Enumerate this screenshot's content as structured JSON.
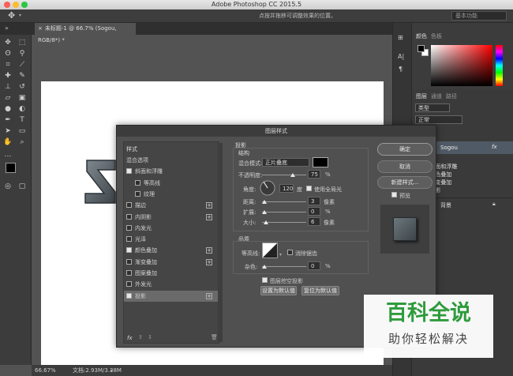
{
  "app": {
    "title": "Adobe Photoshop CC 2015.5"
  },
  "options_bar": {
    "hint": "点按并拖移可调整效果的位置。",
    "workspace": "基本功能"
  },
  "document": {
    "tab_label": "未标题-1 @ 66.7% (Sogou, RGB/8*) *",
    "close_glyph": "×"
  },
  "status": {
    "zoom": "66.67%",
    "doc_size": "文档:2.93M/3.38M"
  },
  "panels": {
    "color_tabs": [
      "颜色",
      "色板"
    ],
    "layer_tabs": [
      "图层",
      "通道",
      "路径"
    ],
    "filter_kind": "类型",
    "blend_mode": "正常",
    "layer_name": "Sogou",
    "fx_glyph": "fx",
    "effects_label": "效果",
    "effects": [
      "斜面和浮雕",
      "颜色叠加",
      "渐变叠加",
      "投影"
    ],
    "background_layer": "背景"
  },
  "dialog": {
    "title": "图层样式",
    "list_header": "样式",
    "styles": [
      {
        "label": "混合选项",
        "checkbox": false,
        "plus": false,
        "checked": false,
        "indent": false
      },
      {
        "label": "斜面和浮雕",
        "checkbox": true,
        "plus": false,
        "checked": true,
        "indent": false
      },
      {
        "label": "等高线",
        "checkbox": true,
        "plus": false,
        "checked": false,
        "indent": true
      },
      {
        "label": "纹理",
        "checkbox": true,
        "plus": false,
        "checked": false,
        "indent": true
      },
      {
        "label": "描边",
        "checkbox": true,
        "plus": true,
        "checked": false,
        "indent": false
      },
      {
        "label": "内阴影",
        "checkbox": true,
        "plus": true,
        "checked": false,
        "indent": false
      },
      {
        "label": "内发光",
        "checkbox": true,
        "plus": false,
        "checked": false,
        "indent": false
      },
      {
        "label": "光泽",
        "checkbox": true,
        "plus": false,
        "checked": false,
        "indent": false
      },
      {
        "label": "颜色叠加",
        "checkbox": true,
        "plus": true,
        "checked": true,
        "indent": false
      },
      {
        "label": "渐变叠加",
        "checkbox": true,
        "plus": true,
        "checked": false,
        "indent": false
      },
      {
        "label": "图案叠加",
        "checkbox": true,
        "plus": false,
        "checked": false,
        "indent": false
      },
      {
        "label": "外发光",
        "checkbox": true,
        "plus": false,
        "checked": false,
        "indent": false
      },
      {
        "label": "投影",
        "checkbox": true,
        "plus": true,
        "checked": true,
        "indent": false
      }
    ],
    "footer_fx": "fx",
    "section_title": "投影",
    "structure": {
      "title": "结构",
      "blend_mode_label": "混合模式:",
      "blend_mode_value": "正片叠底",
      "opacity_label": "不透明度:",
      "opacity_value": "75",
      "percent": "%",
      "angle_label": "角度:",
      "angle_value": "120",
      "degree": "度",
      "global_light_label": "使用全局光",
      "distance_label": "距离:",
      "distance_value": "3",
      "spread_label": "扩展:",
      "spread_value": "0",
      "size_label": "大小:",
      "size_value": "6",
      "pixel_unit": "像素"
    },
    "quality": {
      "title": "品质",
      "contour_label": "等高线:",
      "anti_alias_label": "消除锯齿",
      "noise_label": "杂色:",
      "noise_value": "0"
    },
    "knockout_label": "图层挖空投影",
    "set_default": "设置为默认值",
    "reset_default": "复位为默认值",
    "buttons": {
      "ok": "确定",
      "cancel": "取消",
      "new_style": "新建样式...",
      "preview": "预览"
    }
  },
  "watermark": {
    "line1": "百科全说",
    "line2": "助你轻松解决"
  },
  "colors": {
    "accent_blue": "#2f7de1",
    "watermark_green": "#2e9b3c"
  }
}
